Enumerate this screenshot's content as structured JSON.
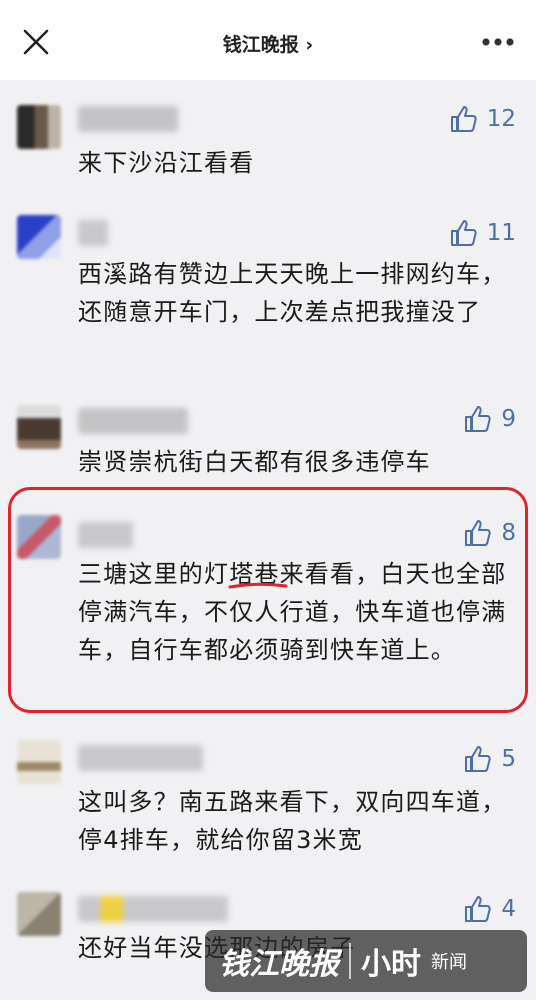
{
  "header": {
    "title": "钱江晚报 ›",
    "close_icon": "close-icon",
    "more_icon": "more-horizontal-icon"
  },
  "comments": [
    {
      "likes": "12",
      "text": "来下沙沿江看看"
    },
    {
      "likes": "11",
      "text": "西溪路有赞边上天天晚上一排网约车，还随意开车门，上次差点把我撞没了"
    },
    {
      "likes": "9",
      "text": "崇贤崇杭街白天都有很多违停车"
    },
    {
      "likes": "8",
      "text": "三塘这里的灯塔巷来看看，白天也全部停满汽车，不仅人行道，快车道也停满车，自行车都必须骑到快车道上。"
    },
    {
      "likes": "5",
      "text": "这叫多？南五路来看下，双向四车道，停4排车，就给你留3米宽"
    },
    {
      "likes": "4",
      "text": "还好当年没选那边的房子"
    }
  ],
  "watermark": {
    "logo": "钱江晚报",
    "brand": "小时",
    "news": "新闻"
  },
  "colors": {
    "accent": "#4d6fa8",
    "highlight": "#e0252a",
    "background": "#f1f1f3"
  }
}
